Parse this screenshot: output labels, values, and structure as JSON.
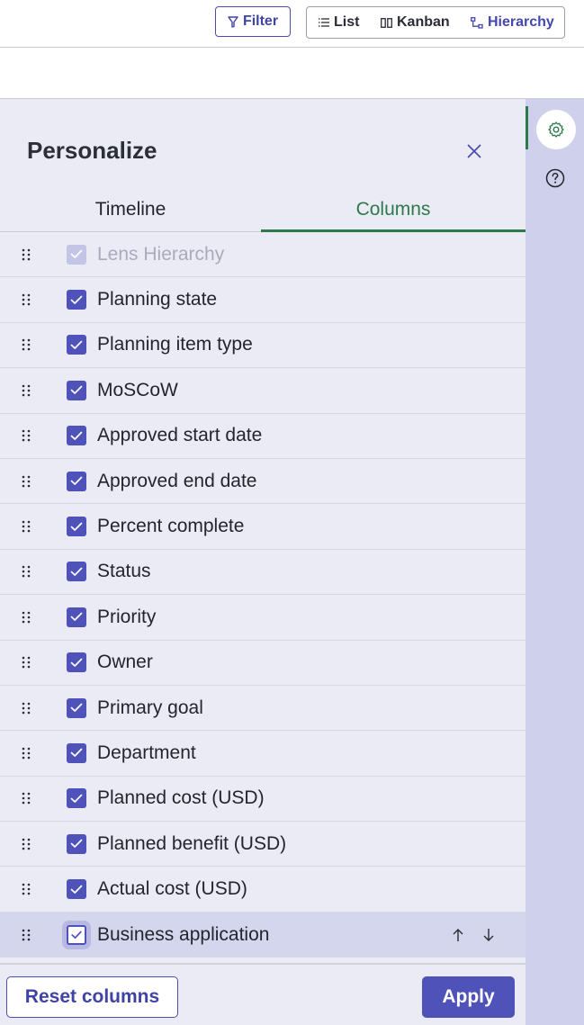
{
  "toolbar": {
    "filter_label": "Filter",
    "views": [
      {
        "label": "List",
        "icon": "list-icon"
      },
      {
        "label": "Kanban",
        "icon": "kanban-icon"
      },
      {
        "label": "Hierarchy",
        "icon": "hierarchy-icon",
        "active": true
      }
    ]
  },
  "panel": {
    "title": "Personalize",
    "tabs": [
      {
        "label": "Timeline",
        "active": false
      },
      {
        "label": "Columns",
        "active": true
      }
    ],
    "columns": [
      {
        "label": "Lens Hierarchy",
        "checked": true,
        "disabled": true
      },
      {
        "label": "Planning state",
        "checked": true
      },
      {
        "label": "Planning item type",
        "checked": true
      },
      {
        "label": "MoSCoW",
        "checked": true
      },
      {
        "label": "Approved start date",
        "checked": true
      },
      {
        "label": "Approved end date",
        "checked": true
      },
      {
        "label": "Percent complete",
        "checked": true
      },
      {
        "label": "Status",
        "checked": true
      },
      {
        "label": "Priority",
        "checked": true
      },
      {
        "label": "Owner",
        "checked": true
      },
      {
        "label": "Primary goal",
        "checked": true
      },
      {
        "label": "Department",
        "checked": true
      },
      {
        "label": "Planned cost (USD)",
        "checked": true
      },
      {
        "label": "Planned benefit (USD)",
        "checked": true
      },
      {
        "label": "Actual cost (USD)",
        "checked": true
      },
      {
        "label": "Business application",
        "checked": true,
        "selected": true
      }
    ],
    "reset_label": "Reset columns",
    "apply_label": "Apply"
  },
  "colors": {
    "accent": "#4f52b8",
    "active_tab": "#2d7a4a",
    "panel_bg": "#ebebf6",
    "rail_bg": "#cfd1ec"
  }
}
